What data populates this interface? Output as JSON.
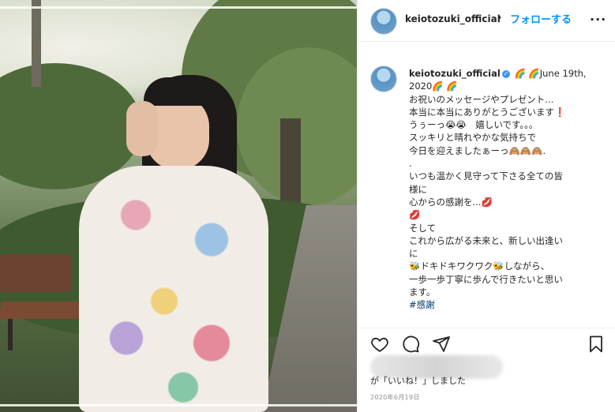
{
  "photo": {
    "description_name": "post-photo"
  },
  "header": {
    "username": "keiotozuki_official",
    "separator": "•",
    "follow_label": "フォローする",
    "more_label": "..."
  },
  "caption": {
    "username": "keiotozuki_official",
    "verified_icon": "✓",
    "lines": [
      "🌈 🌈June 19th,",
      "2020🌈 🌈",
      "お祝いのメッセージやプレゼント...",
      "本当に本当にありがとうございます❗",
      "うぅーっ😭😭　嬉しいです。。。",
      "スッキリと晴れやかな気持ちで",
      "今日を迎えましたぁーっ🙈🙈🙈.",
      ".",
      "いつも温かく見守って下さる全ての皆",
      "様に",
      "心からの感謝を...💋",
      "💋",
      "そして",
      "これから広がる未来と、新しい出逢い",
      "に",
      "🐝ドキドキワクワク🐝しながら、",
      "一歩一歩丁寧に歩んで行きたいと思い",
      "ます。"
    ],
    "hashtag": "#感謝"
  },
  "actions": {
    "like_icon": "heart-icon",
    "comment_icon": "comment-icon",
    "share_icon": "paper-plane-icon",
    "save_icon": "bookmark-icon"
  },
  "likes": {
    "text": "が「いいね！」しました"
  },
  "date": "2020年6月19日",
  "colors": {
    "link_blue": "#0095f6",
    "text": "#262626",
    "muted": "#8e8e8e",
    "verified": "#3897f0"
  }
}
